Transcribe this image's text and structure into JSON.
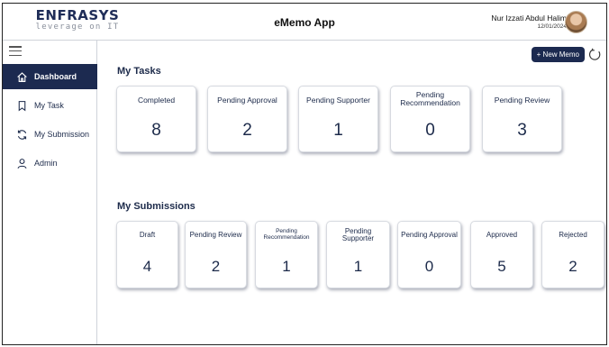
{
  "header": {
    "logo_name": "ENFRASYS",
    "logo_tagline": "leverage on IT",
    "app_title": "eMemo App",
    "user_name": "Nur Izzati Abdul Halim",
    "user_date": "12/01/2024"
  },
  "sidebar": {
    "items": [
      {
        "label": "Dashboard",
        "icon": "home-icon",
        "active": true
      },
      {
        "label": "My Task",
        "icon": "bookmark-icon",
        "active": false
      },
      {
        "label": "My Submission",
        "icon": "refresh-icon",
        "active": false
      },
      {
        "label": "Admin",
        "icon": "user-icon",
        "active": false
      }
    ]
  },
  "main": {
    "new_memo_label": "+ New Memo",
    "tasks_title": "My Tasks",
    "tasks": [
      {
        "label": "Completed",
        "value": "8"
      },
      {
        "label": "Pending Approval",
        "value": "2"
      },
      {
        "label": "Pending Supporter",
        "value": "1"
      },
      {
        "label": "Pending Recommendation",
        "value": "0"
      },
      {
        "label": "Pending Review",
        "value": "3"
      }
    ],
    "submissions_title": "My Submissions",
    "submissions": [
      {
        "label": "Draft",
        "value": "4"
      },
      {
        "label": "Pending Review",
        "value": "2"
      },
      {
        "label": "Pending Recommendation",
        "value": "1"
      },
      {
        "label": "Pending Supporter",
        "value": "1"
      },
      {
        "label": "Pending Approval",
        "value": "0"
      },
      {
        "label": "Approved",
        "value": "5"
      },
      {
        "label": "Rejected",
        "value": "2"
      }
    ]
  },
  "colors": {
    "primary": "#1c2a50",
    "text": "#1c2a4a",
    "border": "#d7dae0"
  }
}
